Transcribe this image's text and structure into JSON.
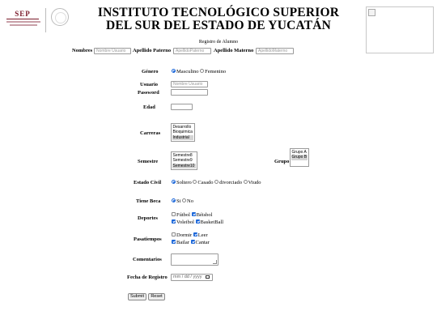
{
  "header": {
    "logo_text": "SEP",
    "title_line1": "INSTITUTO TECNOLÓGICO SUPERIOR",
    "title_line2": "DEL SUR DEL ESTADO DE YUCATÁN",
    "subtitle": "Registro de Alumno"
  },
  "names": {
    "nombres_label": "Nombres",
    "nombres_placeholder": "Nombre Usuario",
    "paterno_label": "Apellido Paterno",
    "paterno_placeholder": "ApellidoPaterno",
    "materno_label": "Apellido Materno",
    "materno_placeholder": "ApellidoMaterno"
  },
  "genero": {
    "label": "Género",
    "options": [
      "Masculino",
      "Femenino"
    ],
    "selected": "Masculino"
  },
  "usuario": {
    "label": "Usuario",
    "placeholder": "Nombre Usuario"
  },
  "password": {
    "label": "Password"
  },
  "edad": {
    "label": "Edad"
  },
  "carreras": {
    "label": "Carreras",
    "options": [
      "Desarrollo",
      "Bioquimica",
      "Industrial"
    ],
    "selected": "Industrial"
  },
  "semestre": {
    "label": "Semestre",
    "options": [
      "Semestre8",
      "Semestre9",
      "Semestre10"
    ],
    "selected": "Semestre10"
  },
  "grupo": {
    "label": "Grupo",
    "options": [
      "Grupo A",
      "Grupo B"
    ],
    "selected": "Grupo B"
  },
  "estado_civil": {
    "label": "Estado Civil",
    "options": [
      "Soltero",
      "Casado",
      "divorciado",
      "Viudo"
    ],
    "selected": "Soltero"
  },
  "beca": {
    "label": "Tiene Beca",
    "options": [
      "Si",
      "No"
    ],
    "selected": "Si"
  },
  "deportes": {
    "label": "Deportes",
    "items": [
      {
        "label": "Fútbol",
        "checked": false
      },
      {
        "label": "Béisbol",
        "checked": true
      },
      {
        "label": "Voleibol",
        "checked": true
      },
      {
        "label": "BasketBall",
        "checked": true
      }
    ]
  },
  "pasatiempos": {
    "label": "Pasatiempos",
    "items": [
      {
        "label": "Dormir",
        "checked": false
      },
      {
        "label": "Leer",
        "checked": true
      },
      {
        "label": "Bailar",
        "checked": true
      },
      {
        "label": "Cantar",
        "checked": true
      }
    ]
  },
  "comentarios": {
    "label": "Comentarios"
  },
  "fecha": {
    "label": "Fecha de Registro",
    "placeholder": "mm / dd / yyyy"
  },
  "buttons": {
    "submit": "Submit",
    "reset": "Reset"
  },
  "colors": {
    "accent": "#1a66d9",
    "sep_brand": "#7a1a2a"
  },
  "icons": {
    "broken_image": "broken-image-icon",
    "calendar": "calendar-icon"
  }
}
